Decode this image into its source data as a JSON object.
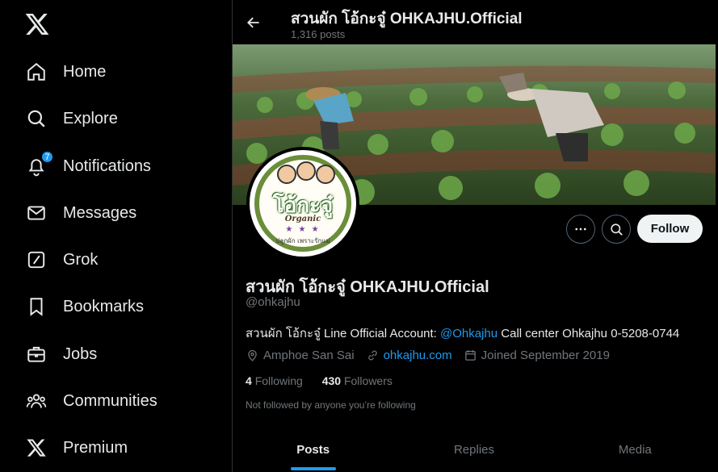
{
  "sidebar": {
    "logo_icon": "x-logo-icon",
    "items": [
      {
        "label": "Home",
        "icon": "home-icon"
      },
      {
        "label": "Explore",
        "icon": "search-icon"
      },
      {
        "label": "Notifications",
        "icon": "bell-icon",
        "badge": "7"
      },
      {
        "label": "Messages",
        "icon": "envelope-icon"
      },
      {
        "label": "Grok",
        "icon": "grok-icon"
      },
      {
        "label": "Bookmarks",
        "icon": "bookmark-icon"
      },
      {
        "label": "Jobs",
        "icon": "briefcase-icon"
      },
      {
        "label": "Communities",
        "icon": "people-icon"
      },
      {
        "label": "Premium",
        "icon": "x-premium-icon"
      }
    ]
  },
  "header": {
    "title": "สวนผัก โอ้กะจู๋ OHKAJHU.Official",
    "post_count": "1,316 posts"
  },
  "avatar": {
    "logo_text": "โอ้กะจู๋",
    "organic_text": "Organic",
    "slogan_text": "ปลูกผัก เพราะรักแม่"
  },
  "profile": {
    "name": "สวนผัก โอ้กะจู๋ OHKAJHU.Official",
    "handle": "@ohkajhu",
    "bio_prefix": "สวนผัก โอ้กะจู๋ Line Official Account: ",
    "bio_link": "@Ohkajhu",
    "bio_suffix": " Call center Ohkajhu 0-5208-0744",
    "location": "Amphoe San Sai",
    "website": "ohkajhu.com",
    "joined": "Joined September 2019",
    "following_count": "4",
    "following_label": "Following",
    "followers_count": "430",
    "followers_label": "Followers",
    "not_followed": "Not followed by anyone you’re following",
    "follow_button": "Follow"
  },
  "tabs": [
    {
      "label": "Posts",
      "active": true
    },
    {
      "label": "Replies",
      "active": false
    },
    {
      "label": "Media",
      "active": false
    }
  ],
  "colors": {
    "accent": "#1d9bf0",
    "background": "#000000",
    "text": "#e7e9ea",
    "muted": "#71767b"
  }
}
